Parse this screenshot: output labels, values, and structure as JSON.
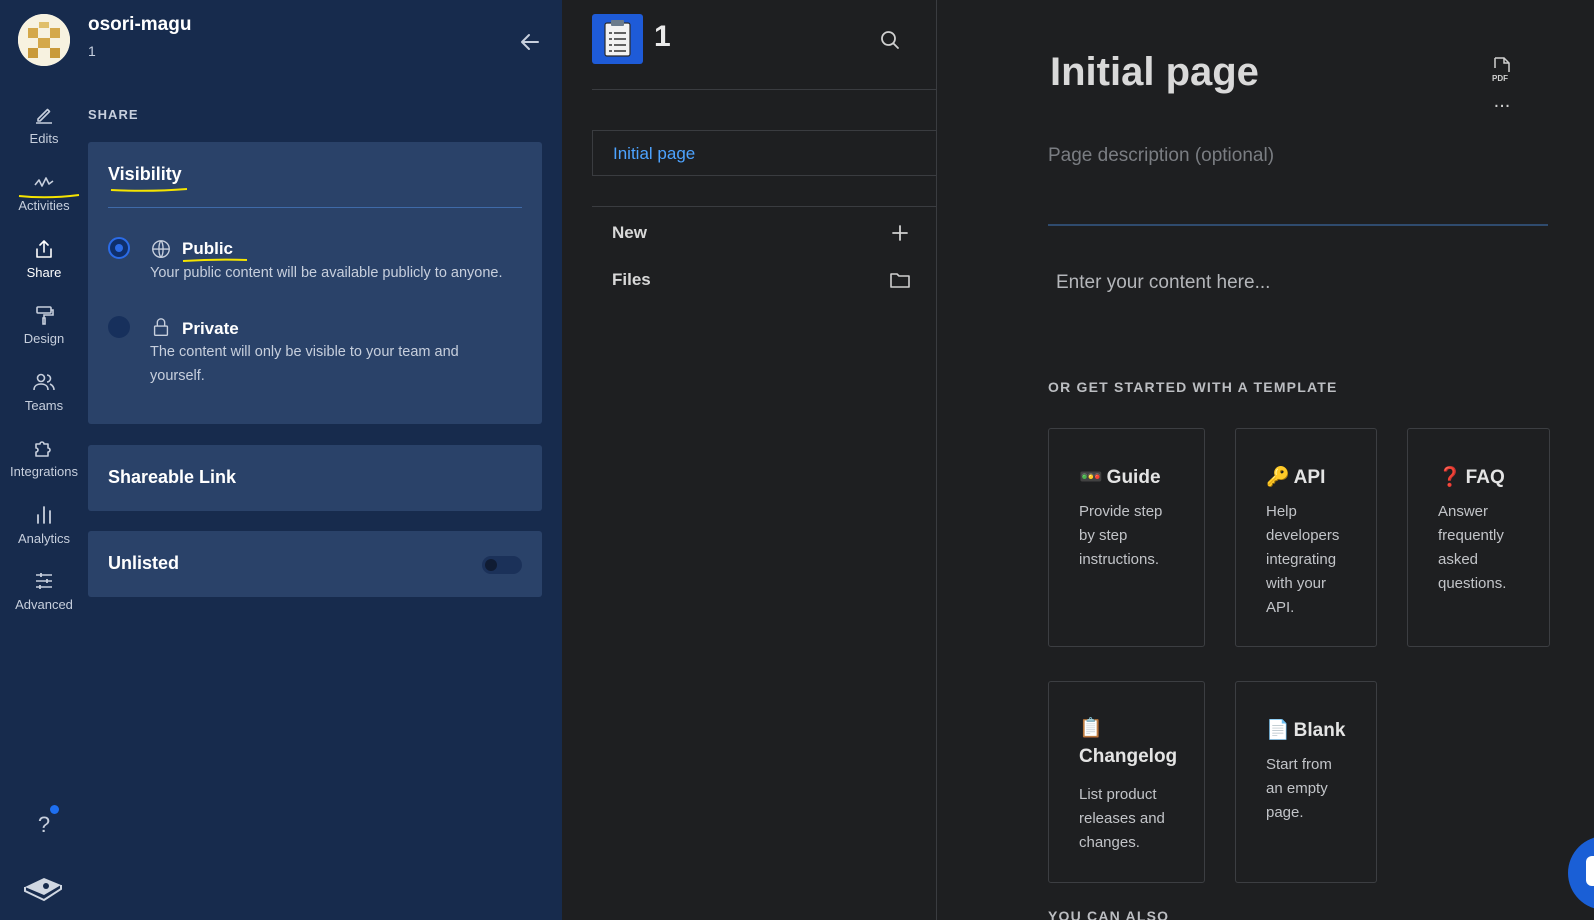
{
  "org": {
    "name": "osori-magu",
    "sub": "1"
  },
  "rail": {
    "items": [
      {
        "label": "Edits"
      },
      {
        "label": "Activities"
      },
      {
        "label": "Share"
      },
      {
        "label": "Design"
      },
      {
        "label": "Teams"
      },
      {
        "label": "Integrations"
      },
      {
        "label": "Analytics"
      },
      {
        "label": "Advanced"
      }
    ],
    "active": "Share",
    "help": "?"
  },
  "share": {
    "section_title": "SHARE",
    "visibility": {
      "title": "Visibility",
      "selected": "Public",
      "options": [
        {
          "label": "Public",
          "desc": "Your public content will be available publicly to anyone."
        },
        {
          "label": "Private",
          "desc": "The content will only be visible to your team and yourself."
        }
      ]
    },
    "shareable_link": {
      "title": "Shareable Link"
    },
    "unlisted": {
      "title": "Unlisted",
      "enabled": false
    }
  },
  "space": {
    "name": "1",
    "pages": [
      {
        "label": "Initial page"
      }
    ],
    "actions": [
      {
        "label": "New"
      },
      {
        "label": "Files"
      }
    ]
  },
  "page": {
    "title": "Initial page",
    "pdf_label": "PDF",
    "more": "...",
    "description_placeholder": "Page description (optional)",
    "content_placeholder": "Enter your content here...",
    "templates_heading": "OR GET STARTED WITH A TEMPLATE",
    "templates": [
      {
        "emoji": "🚥",
        "title": "Guide",
        "desc_lines": [
          "Provide step",
          "by step",
          "instructions."
        ]
      },
      {
        "emoji": "🔑",
        "title": "API",
        "desc_lines": [
          "Help",
          "developers",
          "integrating",
          "with your",
          "API."
        ]
      },
      {
        "emoji": "❓",
        "title": "FAQ",
        "desc_lines": [
          "Answer",
          "frequently",
          "asked",
          "questions."
        ]
      },
      {
        "emoji": "📋",
        "title": "Changelog",
        "desc_lines": [
          "List product",
          "releases and",
          "changes."
        ]
      },
      {
        "emoji": "📄",
        "title": "Blank",
        "desc_lines": [
          "Start from",
          "an empty",
          "page."
        ]
      }
    ],
    "more_heading": "YOU CAN ALSO"
  },
  "colors": {
    "panel": "#172b4d",
    "card": "#2a4269",
    "accent": "#2b6be6",
    "link": "#4da3ff",
    "highlight_marker": "#f5e400"
  }
}
